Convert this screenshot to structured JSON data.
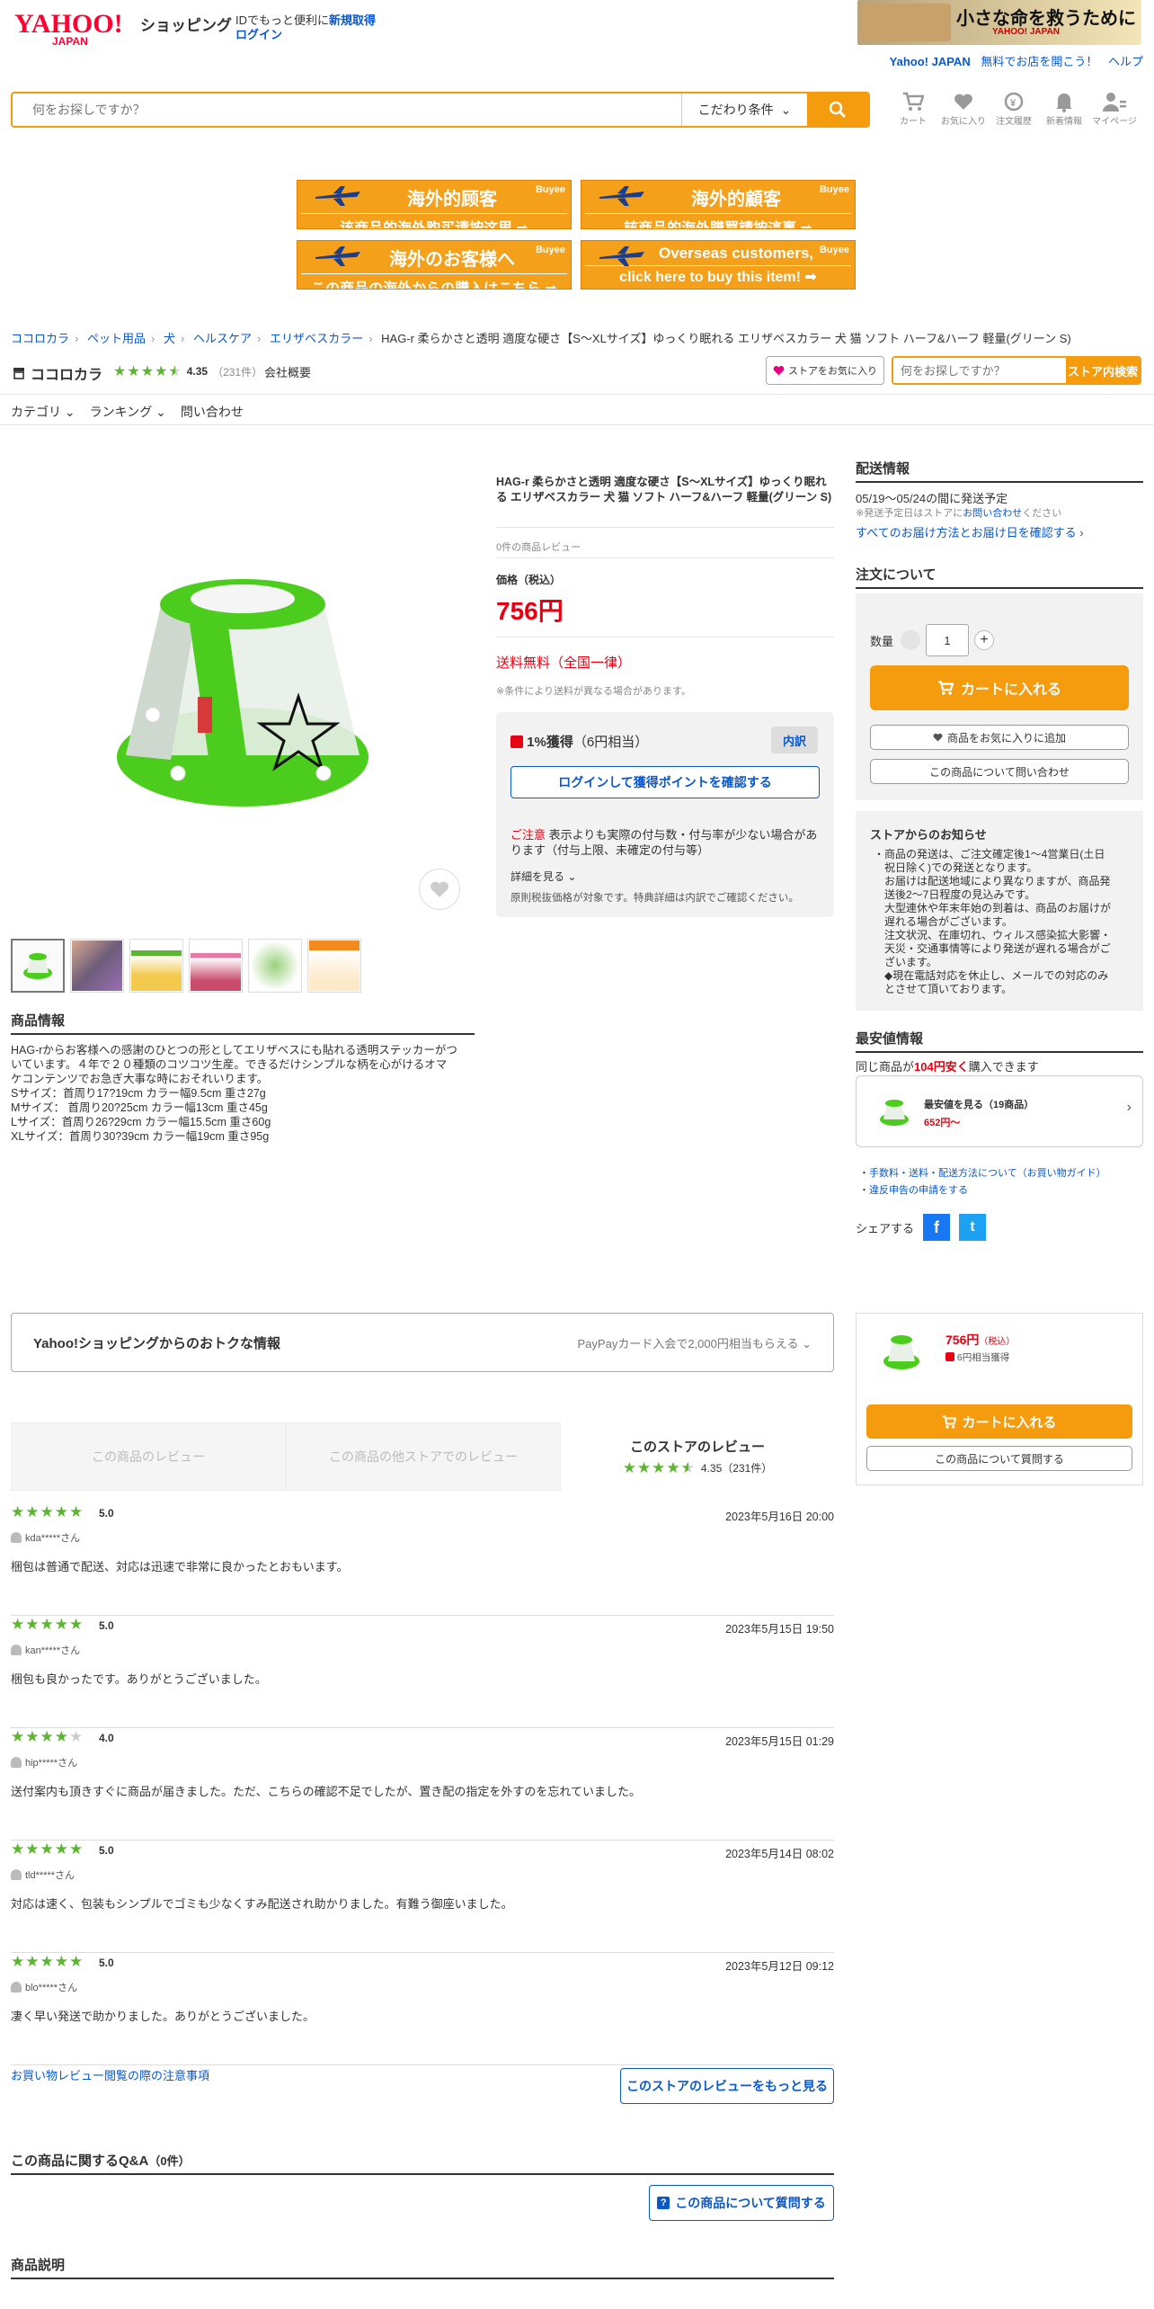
{
  "header": {
    "logo_text": "YAHOO! JAPAN",
    "shopping": "ショッピング",
    "promo_text": "IDでもっと便利に",
    "register_link": "新規取得",
    "login_link": "ログイン",
    "banner_title": "小さな命を救うために",
    "banner_sub": "YAHOO! JAPAN",
    "links": [
      "Yahoo! JAPAN",
      "無料でお店を開こう！",
      "ヘルプ"
    ],
    "search_placeholder": "何をお探しですか？",
    "search_condition": "こだわり条件",
    "icons": [
      {
        "label": "カート",
        "icon": "cart-icon"
      },
      {
        "label": "お気に入り",
        "icon": "heart-icon"
      },
      {
        "label": "注文履歴",
        "icon": "history-icon"
      },
      {
        "label": "新着情報",
        "icon": "bell-icon"
      },
      {
        "label": "マイページ",
        "icon": "user-icon"
      }
    ]
  },
  "buyee": [
    {
      "line1": "海外的顾客",
      "line2": "该商品的海外购买请按这里 ➡"
    },
    {
      "line1": "海外的顧客",
      "line2": "該商品的海外購買請按這裏 ➡"
    },
    {
      "line1": "海外のお客様へ",
      "line2": "この商品の海外からの購入はこちら ➡"
    },
    {
      "line1": "Overseas customers,",
      "line2": "click here to buy this item! ➡"
    }
  ],
  "buyee_logo": "Buyee",
  "breadcrumb": [
    "ココロカラ",
    "ペット用品",
    "犬",
    "ヘルスケア",
    "エリザベスカラー",
    "HAG-r 柔らかさと透明 適度な硬さ【S〜XLサイズ】ゆっくり眠れる エリザベスカラー 犬 猫 ソフト ハーフ&ハーフ 軽量(グリーン S)"
  ],
  "store": {
    "name": "ココロカラ",
    "rating": "4.35",
    "count": "（231件）",
    "corp": "会社概要",
    "fav": "ストアをお気に入り",
    "search_placeholder": "何をお探しですか？",
    "search_btn": "ストア内検索"
  },
  "catnav": [
    "カテゴリ",
    "ランキング",
    "問い合わせ"
  ],
  "product": {
    "title": "HAG-r 柔らかさと透明 適度な硬さ【S〜XLサイズ】ゆっくり眠れる エリザベスカラー 犬 猫 ソフト ハーフ&ハーフ 軽量(グリーン S)",
    "reviews": "0件の商品レビュー",
    "price_label": "価格（税込）",
    "price": "756円",
    "shipping": "送料無料（全国一律）",
    "shipping_note": "※条件により送料が異なる場合があります。",
    "points_gain": "1%獲得",
    "points_equiv": "（6円相当）",
    "breakdown": "内訳",
    "login_points": "ログインして獲得ポイントを確認する",
    "caution_label": "ご注意",
    "caution_text": "表示よりも実際の付与数・付与率が少ない場合があります（付与上限、未確定の付与等）",
    "detail": "詳細を見る",
    "principle": "原則税抜価格が対象です。特典詳細は内訳でご確認ください。",
    "info_heading": "商品情報",
    "info_lines": [
      "HAG-rからお客様への感謝のひとつの形としてエリザベスにも貼れる透明ステッカーがつ",
      "いています。４年で２０種類のコツコツ生産。できるだけシンプルな柄を心がけるオマ",
      "ケコンテンツでお急ぎ大事な時におそれいります。",
      "Sサイズ：首周り17?19cm カラー幅9.5cm 重さ27g",
      "Mサイズ： 首周り20?25cm カラー幅13cm 重さ45g",
      "Lサイズ：首周り26?29cm カラー幅15.5cm 重さ60g",
      "XLサイズ：首周り30?39cm カラー幅19cm 重さ95g"
    ]
  },
  "delivery": {
    "heading": "配送情報",
    "dates": "05/19〜05/24の間に発送予定",
    "note_prefix": "※発送予定日はストアに",
    "note_link": "お問い合わせ",
    "note_suffix": "ください",
    "link": "すべてのお届け方法とお届け日を確認する"
  },
  "order": {
    "heading": "注文について",
    "qty_label": "数量",
    "qty": "1",
    "cart": "カートに入れる",
    "fav": "商品をお気に入りに追加",
    "inquiry": "この商品について問い合わせ"
  },
  "notice": {
    "heading": "ストアからのお知らせ",
    "lines": [
      "・商品の発送は、ご注文確定後1～4営業日(土日",
      "　祝日除く)での発送となります。",
      "　お届けは配送地域により異なりますが、商品発",
      "　送後2～7日程度の見込みです。",
      "　大型連休や年末年始の到着は、商品のお届けが",
      "　遅れる場合がございます。",
      "　注文状況、在庫切れ、ウィルス感染拡大影響・",
      "　天災・交通事情等により発送が遅れる場合がご",
      "　ざいます。",
      "　◆現在電話対応を休止し、メールでの対応のみ",
      "　とさせて頂いております。"
    ]
  },
  "cheapest": {
    "heading": "最安値情報",
    "line_prefix": "同じ商品が",
    "line_amount": "104円安く",
    "line_suffix": "購入できます",
    "title": "最安値を見る（19商品）",
    "price": "652円〜",
    "links": [
      "手数料・送料・配送方法について（お買い物ガイド）",
      "違反申告の申請をする"
    ],
    "share": "シェアする"
  },
  "otoku": {
    "left": "Yahoo!ショッピングからのおトクな情報",
    "right": "PayPayカード入会で2,000円相当もらえる"
  },
  "tabs": [
    "この商品のレビュー",
    "この商品の他ストアでのレビュー",
    "このストアのレビュー"
  ],
  "store_review_summary": "4.35（231件）",
  "reviews": [
    {
      "stars": 5,
      "score": "5.0",
      "date": "2023年5月16日 20:00",
      "user": "kda*****さん",
      "body": "梱包は普通で配送、対応は迅速で非常に良かったとおもいます。"
    },
    {
      "stars": 5,
      "score": "5.0",
      "date": "2023年5月15日 19:50",
      "user": "kan*****さん",
      "body": "梱包も良かったです。ありがとうございました。"
    },
    {
      "stars": 4,
      "score": "4.0",
      "date": "2023年5月15日 01:29",
      "user": "hip*****さん",
      "body": "送付案内も頂きすぐに商品が届きました。ただ、こちらの確認不足でしたが、置き配の指定を外すのを忘れていました。"
    },
    {
      "stars": 5,
      "score": "5.0",
      "date": "2023年5月14日 08:02",
      "user": "tld*****さん",
      "body": "対応は速く、包装もシンプルでゴミも少なくすみ配送され助かりました。有難う御座いました。"
    },
    {
      "stars": 5,
      "score": "5.0",
      "date": "2023年5月12日 09:12",
      "user": "blo*****さん",
      "body": "凄く早い発送で助かりました。ありがとうございました。"
    }
  ],
  "review_note_link": "お買い物レビュー閲覧の際の注意事項",
  "review_more": "このストアのレビューをもっと見る",
  "qa": {
    "heading": "この商品に関するQ&A",
    "count": "（0件）",
    "button": "この商品について質問する"
  },
  "desc_heading": "商品説明",
  "sticky": {
    "price": "756円",
    "tax": "（税込）",
    "points": "6円相当獲得",
    "cart": "カートに入れる",
    "question": "この商品について質問する"
  },
  "colors": {
    "orange": "#f59c0e",
    "red": "#e60012",
    "green": "#5cb531",
    "link": "#0a58ca"
  }
}
